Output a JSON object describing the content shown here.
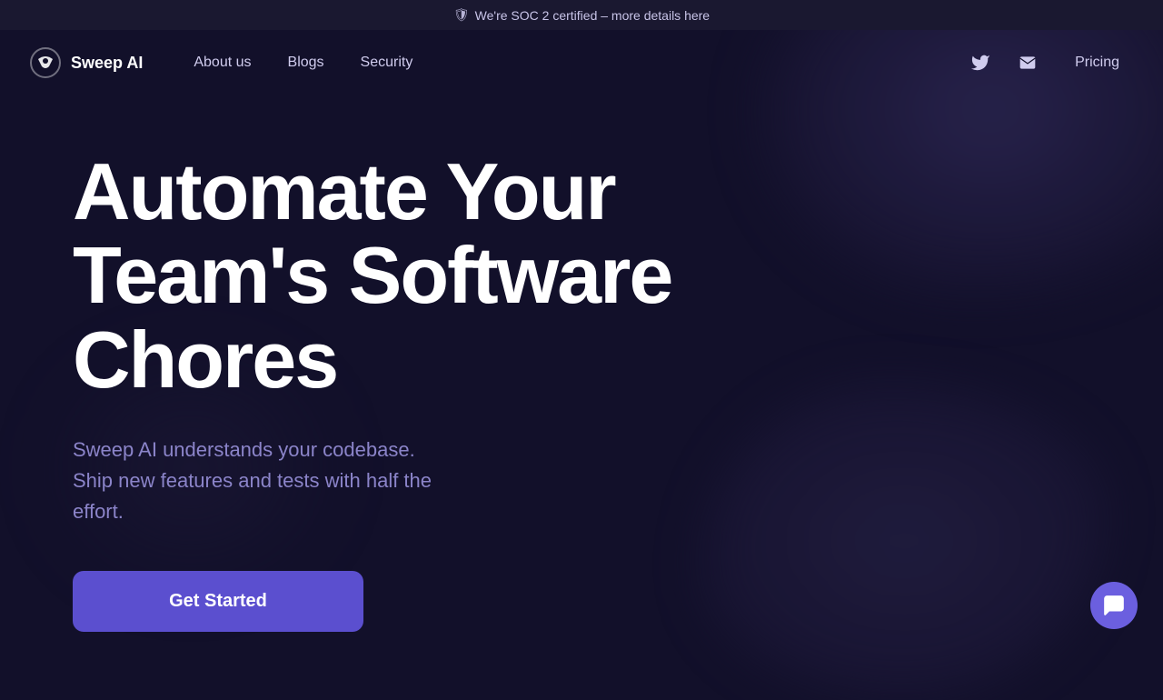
{
  "banner": {
    "icon": "🛡",
    "text": "We're SOC 2 certified – more details here"
  },
  "nav": {
    "logo_text": "Sweep AI",
    "links": [
      {
        "label": "About us",
        "id": "about-us"
      },
      {
        "label": "Blogs",
        "id": "blogs"
      },
      {
        "label": "Security",
        "id": "security"
      }
    ],
    "pricing_label": "Pricing"
  },
  "hero": {
    "title": "Automate Your Team's Software Chores",
    "subtitle": "Sweep AI understands your codebase. Ship new features and tests with half the effort.",
    "cta_label": "Get Started"
  }
}
